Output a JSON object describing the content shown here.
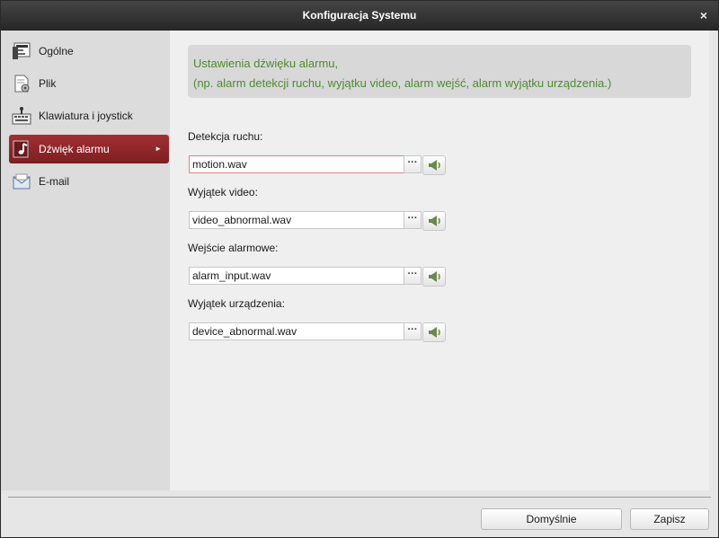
{
  "window": {
    "title": "Konfiguracja Systemu",
    "close_glyph": "×"
  },
  "sidebar": {
    "items": [
      {
        "label": "Ogólne",
        "icon": "general-settings-icon",
        "active": false
      },
      {
        "label": "Plik",
        "icon": "file-gear-icon",
        "active": false
      },
      {
        "label": "Klawiatura i joystick",
        "icon": "keyboard-icon",
        "active": false
      },
      {
        "label": "Dźwięk alarmu",
        "icon": "music-note-icon",
        "active": true
      },
      {
        "label": "E-mail",
        "icon": "email-icon",
        "active": false
      }
    ],
    "active_arrow": "►",
    "active_color": "#8e2629"
  },
  "info": {
    "line1": "Ustawienia dźwięku alarmu,",
    "line2": "(np. alarm detekcji ruchu, wyjątku video, alarm wejść, alarm wyjątku urządzenia.)",
    "text_color": "#4f8a2e"
  },
  "fields": [
    {
      "label": "Detekcja ruchu:",
      "value": "motion.wav"
    },
    {
      "label": "Wyjątek video:",
      "value": "video_abnormal.wav"
    },
    {
      "label": "Wejście alarmowe:",
      "value": "alarm_input.wav"
    },
    {
      "label": "Wyjątek urządzenia:",
      "value": "device_abnormal.wav"
    }
  ],
  "browse_glyph": "···",
  "buttons": {
    "default_label": "Domyślnie",
    "save_label": "Zapisz"
  }
}
